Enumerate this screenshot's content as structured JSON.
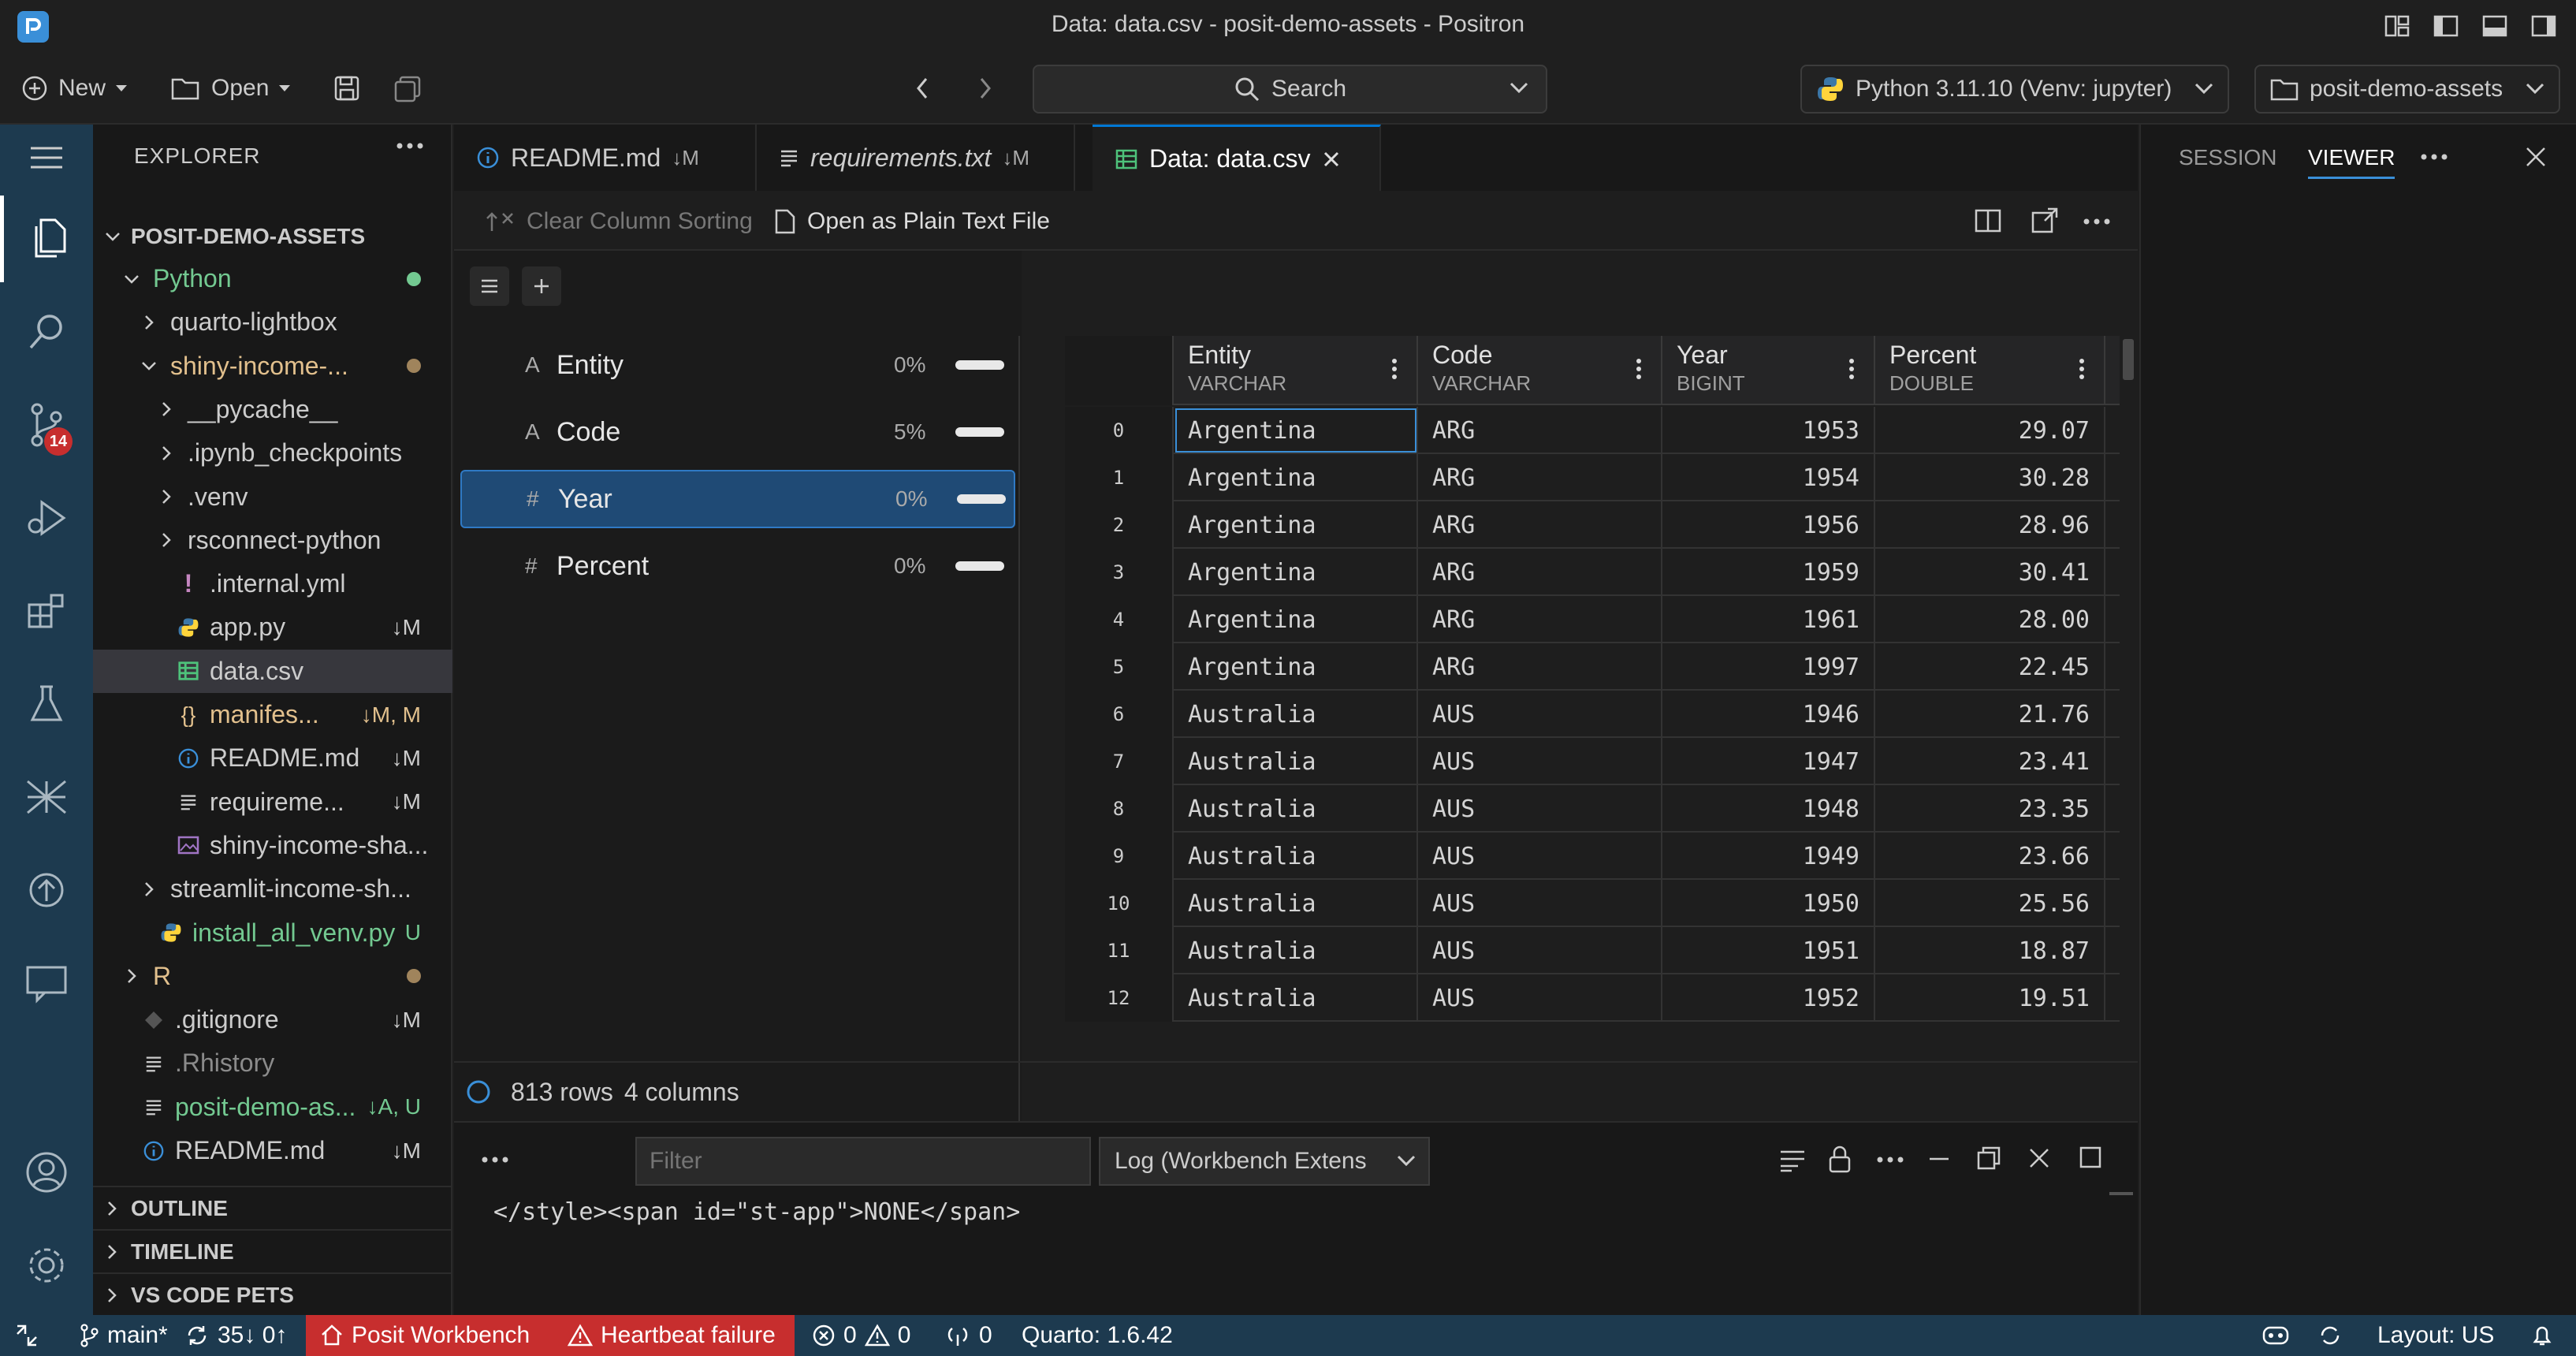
{
  "window": {
    "title": "Data: data.csv - posit-demo-assets - Positron"
  },
  "toolbar": {
    "new_label": "New",
    "open_label": "Open",
    "search_label": "Search",
    "interpreter_label": "Python 3.11.10 (Venv: jupyter)",
    "workspace_label": "posit-demo-assets"
  },
  "activity": {
    "scm_badge": "14"
  },
  "explorer": {
    "header": "EXPLORER",
    "root": "POSIT-DEMO-ASSETS",
    "items": [
      {
        "label": "Python",
        "status": ""
      },
      {
        "label": "quarto-lightbox",
        "status": ""
      },
      {
        "label": "shiny-income-...",
        "status": ""
      },
      {
        "label": "__pycache__",
        "status": ""
      },
      {
        "label": ".ipynb_checkpoints",
        "status": ""
      },
      {
        "label": ".venv",
        "status": ""
      },
      {
        "label": "rsconnect-python",
        "status": ""
      },
      {
        "label": ".internal.yml",
        "status": ""
      },
      {
        "label": "app.py",
        "status": "↓M"
      },
      {
        "label": "data.csv",
        "status": ""
      },
      {
        "label": "manifes...",
        "status": "↓M, M"
      },
      {
        "label": "README.md",
        "status": "↓M"
      },
      {
        "label": "requireme...",
        "status": "↓M"
      },
      {
        "label": "shiny-income-sha...",
        "status": ""
      },
      {
        "label": "streamlit-income-sh...",
        "status": ""
      },
      {
        "label": "install_all_venv.py",
        "status": "U"
      },
      {
        "label": "R",
        "status": ""
      },
      {
        "label": ".gitignore",
        "status": "↓M"
      },
      {
        "label": ".Rhistory",
        "status": ""
      },
      {
        "label": "posit-demo-as...",
        "status": "↓A, U"
      },
      {
        "label": "README.md",
        "status": "↓M"
      }
    ],
    "sections": [
      "OUTLINE",
      "TIMELINE",
      "VS CODE PETS"
    ]
  },
  "tabs": [
    {
      "label": "README.md",
      "status": "↓M"
    },
    {
      "label": "requirements.txt",
      "status": "↓M"
    },
    {
      "label": "Data: data.csv",
      "status": ""
    }
  ],
  "data_toolbar": {
    "clear_sort": "Clear Column Sorting",
    "open_plain": "Open as Plain Text File"
  },
  "summary": [
    {
      "type_glyph": "A",
      "name": "Entity",
      "missing": "0%"
    },
    {
      "type_glyph": "A",
      "name": "Code",
      "missing": "5%"
    },
    {
      "type_glyph": "#",
      "name": "Year",
      "missing": "0%"
    },
    {
      "type_glyph": "#",
      "name": "Percent",
      "missing": "0%"
    }
  ],
  "grid": {
    "columns": [
      {
        "name": "Entity",
        "type": "VARCHAR"
      },
      {
        "name": "Code",
        "type": "VARCHAR"
      },
      {
        "name": "Year",
        "type": "BIGINT"
      },
      {
        "name": "Percent",
        "type": "DOUBLE"
      }
    ],
    "rows": [
      [
        "0",
        "Argentina",
        "ARG",
        "1953",
        "29.07"
      ],
      [
        "1",
        "Argentina",
        "ARG",
        "1954",
        "30.28"
      ],
      [
        "2",
        "Argentina",
        "ARG",
        "1956",
        "28.96"
      ],
      [
        "3",
        "Argentina",
        "ARG",
        "1959",
        "30.41"
      ],
      [
        "4",
        "Argentina",
        "ARG",
        "1961",
        "28.00"
      ],
      [
        "5",
        "Argentina",
        "ARG",
        "1997",
        "22.45"
      ],
      [
        "6",
        "Australia",
        "AUS",
        "1946",
        "21.76"
      ],
      [
        "7",
        "Australia",
        "AUS",
        "1947",
        "23.41"
      ],
      [
        "8",
        "Australia",
        "AUS",
        "1948",
        "23.35"
      ],
      [
        "9",
        "Australia",
        "AUS",
        "1949",
        "23.66"
      ],
      [
        "10",
        "Australia",
        "AUS",
        "1950",
        "25.56"
      ],
      [
        "11",
        "Australia",
        "AUS",
        "1951",
        "18.87"
      ],
      [
        "12",
        "Australia",
        "AUS",
        "1952",
        "19.51"
      ]
    ],
    "row_count": "813 rows",
    "col_count": "4 columns"
  },
  "panel": {
    "filter_placeholder": "Filter",
    "log_select": "Log (Workbench Extens",
    "output_line": "</style><span id=\"st-app\">NONE</span>"
  },
  "right_panel": {
    "tab_session": "SESSION",
    "tab_viewer": "VIEWER"
  },
  "statusbar": {
    "branch": "main*",
    "sync": "35↓ 0↑",
    "workbench": "Posit Workbench",
    "heartbeat": "Heartbeat failure",
    "errors": "0",
    "warnings": "0",
    "ports": "0",
    "quarto": "Quarto: 1.6.42",
    "layout": "Layout: US"
  },
  "colors": {
    "accent": "#0078d4",
    "activity_bg": "#1d3a4f",
    "error_red": "#c72e2e",
    "folder_green": "#73c991",
    "modified_yellow": "#e2c08d"
  }
}
